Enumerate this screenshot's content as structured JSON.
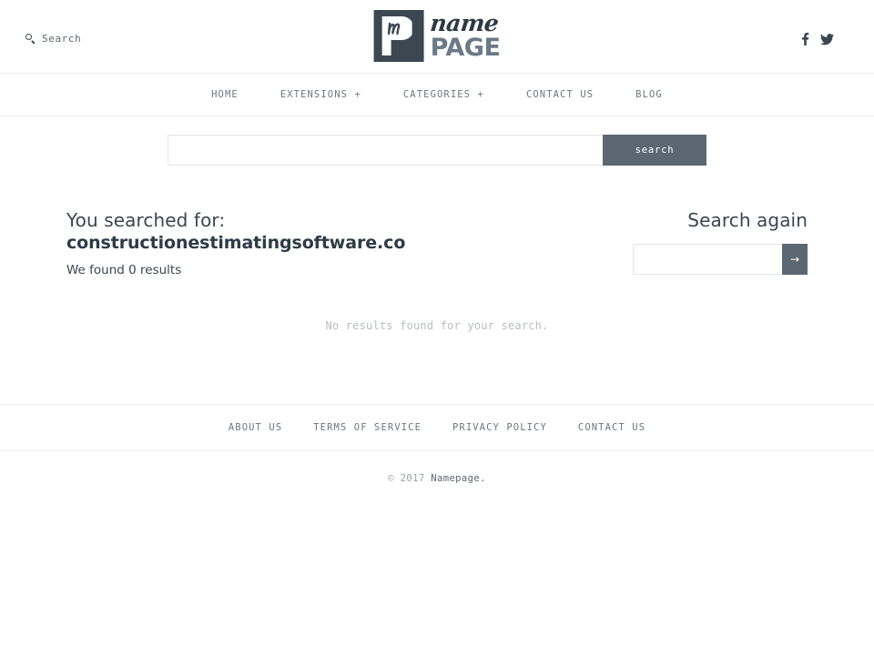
{
  "colors": {
    "accent": "#5b6773",
    "text": "#3b4650",
    "muted": "#6d7780",
    "light": "#b9bdc1",
    "border": "#ececec",
    "logo_dark": "#3d4752",
    "logo_page": "#6c7a87"
  },
  "topbar": {
    "search_label": "Search",
    "search_icon": "search-icon",
    "logo": {
      "mark_icon": "namepage-logo-mark",
      "name_text": "name",
      "page_text": "PAGE"
    },
    "social": [
      {
        "name": "facebook-icon",
        "label": "f"
      },
      {
        "name": "twitter-icon",
        "label": "t"
      }
    ]
  },
  "nav": {
    "items": [
      {
        "label": "HOME"
      },
      {
        "label": "EXTENSIONS +"
      },
      {
        "label": "CATEGORIES +"
      },
      {
        "label": "CONTACT US"
      },
      {
        "label": "BLOG"
      }
    ]
  },
  "search_bar": {
    "value": "",
    "placeholder": "",
    "button_label": "search"
  },
  "results": {
    "searched_label": "You searched for:",
    "searched_term": "constructionestimatingsoftware.co",
    "found_text": "We found 0 results",
    "empty_message": "No results found for your search."
  },
  "search_again": {
    "title": "Search again",
    "value": "",
    "placeholder": "",
    "button_label": "→"
  },
  "footer": {
    "links": [
      {
        "label": "ABOUT US"
      },
      {
        "label": "TERMS OF SERVICE"
      },
      {
        "label": "PRIVACY POLICY"
      },
      {
        "label": "CONTACT US"
      }
    ],
    "copyright_prefix": "© 2017 ",
    "copyright_brand": "Namepage."
  }
}
